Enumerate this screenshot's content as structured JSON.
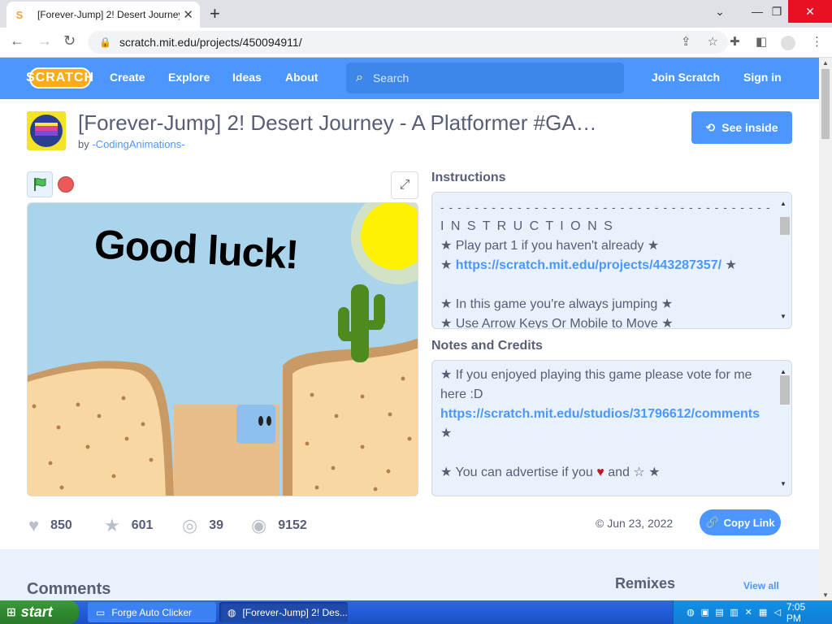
{
  "browser": {
    "tab_title": "[Forever-Jump] 2! Desert Journey",
    "tab_favicon": "S",
    "new_tab": "+",
    "url": "scratch.mit.edu/projects/450094911/"
  },
  "nav": {
    "logo": "SCRATCH",
    "links": [
      "Create",
      "Explore",
      "Ideas",
      "About"
    ],
    "search_placeholder": "Search",
    "join": "Join Scratch",
    "signin": "Sign in"
  },
  "project": {
    "title": "[Forever-Jump] 2! Desert Journey - A Platformer #GA…",
    "by_prefix": "by",
    "author": "-CodingAnimations-",
    "see_inside": "See inside",
    "stage_text": "Good luck!"
  },
  "instructions": {
    "heading": "Instructions",
    "lines": [
      "- - - - - - - - - - - - - - - - - - - - - - - - - - - - - - - - - - - - - - -",
      "I N S T R U C T I O N S",
      "★ Play part 1 if you haven't already ★",
      "",
      "",
      "★ In this game you're always jumping ★",
      "★ Use Arrow Keys Or Mobile to Move ★"
    ],
    "link_prefix": "★ ",
    "link": "https://scratch.mit.edu/projects/443287357/",
    "link_suffix": " ★"
  },
  "notes": {
    "heading": "Notes and Credits",
    "line1": "★ If you enjoyed playing this game please vote for me",
    "line2": "here :D",
    "link": "https://scratch.mit.edu/studios/31796612/comments",
    "line4": "★",
    "line6_a": "★ You can advertise if you ",
    "heart": "♥",
    "line6_b": " and ☆ ★"
  },
  "stats": {
    "loves": "850",
    "favorites": "601",
    "remixes": "39",
    "views": "9152"
  },
  "date": "© Jun 23, 2022",
  "copy_link": "Copy Link",
  "lower": {
    "comments": "Comments",
    "remixes": "Remixes",
    "view_all": "View all"
  },
  "taskbar": {
    "start": "start",
    "items": [
      "Forge Auto Clicker",
      "[Forever-Jump] 2! Des..."
    ],
    "clock": "7:05 PM"
  },
  "colors": {
    "scratch_blue": "#4c97ff",
    "panel_bg": "#e9f1fc",
    "text": "#575e75"
  }
}
